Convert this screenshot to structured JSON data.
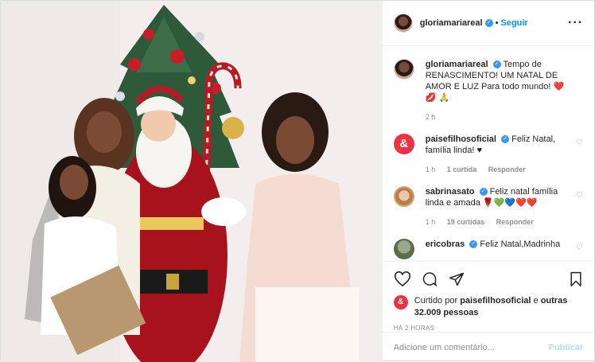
{
  "header": {
    "username": "gloriamariareal",
    "separator": "•",
    "follow_label": "Seguir",
    "more_icon": "more-horizontal-icon"
  },
  "caption": {
    "username": "gloriamariareal",
    "text": "Tempo de RENASCIMENTO! UM NATAL DE AMOR E LUZ Para todo mundo! ❤️ 💋 🙏",
    "time": "2 h"
  },
  "comments": [
    {
      "username": "paisefilhosoficial",
      "avatar_letter": "&",
      "text": "Feliz Natal, família linda! ♥",
      "time": "1 h",
      "likes": "1 curtida",
      "reply": "Responder"
    },
    {
      "username": "sabrinasato",
      "text": "Feliz natal família linda e amada 🌹💚💙❤️❤️",
      "time": "1 h",
      "likes": "19 curtidas",
      "reply": "Responder"
    },
    {
      "username": "ericobras",
      "text": "Feliz Natal,Madrinha"
    }
  ],
  "actions": {
    "like_icon": "heart-icon",
    "comment_icon": "comment-icon",
    "share_icon": "share-icon",
    "save_icon": "bookmark-icon"
  },
  "liked_by": {
    "prefix": "Curtido por",
    "username": "paisefilhosoficial",
    "middle": "e",
    "others": "outras 32.009 pessoas"
  },
  "timestamp": "HÁ 2 HORAS",
  "comment_box": {
    "placeholder": "Adicione um comentário...",
    "publish_label": "Publicar"
  },
  "colors": {
    "accent": "#0095f6",
    "publish_disabled": "#b2dffc",
    "brand_red": "#ea3343"
  }
}
